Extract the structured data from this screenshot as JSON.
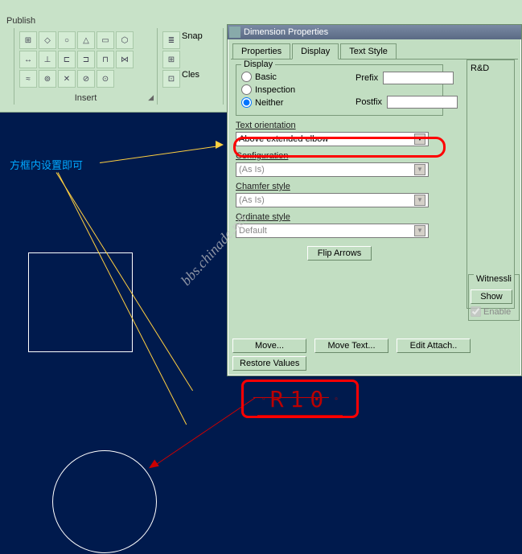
{
  "ribbon": {
    "publish": "Publish",
    "insert_group": "Insert",
    "snap_label": "Snap",
    "cles_label": "Cles"
  },
  "canvas": {
    "annotation_cn": "方框内设置即可",
    "rio_label": "R10"
  },
  "dialog": {
    "title": "Dimension Properties",
    "tabs": {
      "properties": "Properties",
      "display": "Display",
      "text_style": "Text Style"
    },
    "display_group": "Display",
    "radio_basic": "Basic",
    "radio_inspection": "Inspection",
    "radio_neither": "Neither",
    "prefix_label": "Prefix",
    "postfix_label": "Postfix",
    "text_orientation_label": "Text orientation",
    "text_orientation_value": "Above extended elbow",
    "configuration_label": "Configuration",
    "configuration_value": "(As Is)",
    "chamfer_label": "Chamfer style",
    "chamfer_value": "(As Is)",
    "ordinate_label": "Ordinate style",
    "ordinate_value": "Default",
    "flip_arrows": "Flip Arrows",
    "rd_label": "R&D",
    "witness_group": "Witnessli",
    "show_btn": "Show",
    "enable_chk": "Enable",
    "move_btn": "Move...",
    "move_text_btn": "Move Text...",
    "edit_attach_btn": "Edit Attach..",
    "restore_btn": "Restore Values"
  },
  "watermark": "bbs.chinade.net"
}
